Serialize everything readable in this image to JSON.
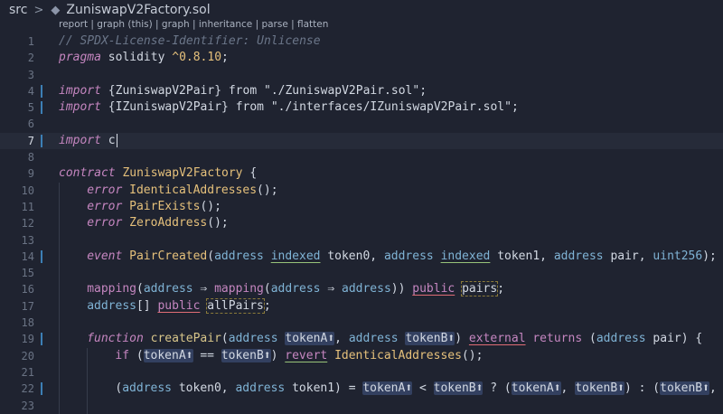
{
  "breadcrumb": {
    "root": "src",
    "separator": ">",
    "file_icon": "ethereum-icon",
    "file": "ZuniswapV2Factory.sol"
  },
  "codelens": "report | graph (this) | graph | inheritance | parse | flatten",
  "colors": {
    "background": "#1f2330",
    "keyword": "#c586c0",
    "type": "#7fb3d5",
    "identifier": "#e5c07b",
    "modified_gutter": "#3c7fb5"
  },
  "lines": [
    {
      "n": "1",
      "t": [
        [
          "c-comment",
          "// SPDX-License-Identifier: Unlicense"
        ]
      ]
    },
    {
      "n": "2",
      "t": [
        [
          "c-kw",
          "pragma"
        ],
        [
          "c-var",
          " solidity "
        ],
        [
          "c-ver",
          "^0.8.10"
        ],
        [
          "c-var",
          ";"
        ]
      ]
    },
    {
      "n": "3",
      "t": []
    },
    {
      "n": "4",
      "mod": true,
      "t": [
        [
          "c-kw",
          "import"
        ],
        [
          "c-var",
          " {ZuniswapV2Pair} "
        ],
        [
          "c-var",
          "from "
        ],
        [
          "c-str",
          "\"./ZuniswapV2Pair.sol\""
        ],
        [
          "c-var",
          ";"
        ]
      ]
    },
    {
      "n": "5",
      "mod": true,
      "t": [
        [
          "c-kw",
          "import"
        ],
        [
          "c-var",
          " {IZuniswapV2Pair} "
        ],
        [
          "c-var",
          "from "
        ],
        [
          "c-str",
          "\"./interfaces/IZuniswapV2Pair.sol\""
        ],
        [
          "c-var",
          ";"
        ]
      ]
    },
    {
      "n": "6",
      "t": []
    },
    {
      "n": "7",
      "mod": true,
      "current": true,
      "cursor": true,
      "t": [
        [
          "c-kw",
          "import"
        ],
        [
          "c-var",
          " c"
        ]
      ]
    },
    {
      "n": "8",
      "t": []
    },
    {
      "n": "9",
      "t": [
        [
          "c-kw",
          "contract"
        ],
        [
          "c-var",
          " "
        ],
        [
          "c-name",
          "ZuniswapV2Factory"
        ],
        [
          "c-var",
          " {"
        ]
      ]
    },
    {
      "n": "10",
      "indent": 1,
      "t": [
        [
          "c-kw",
          "error"
        ],
        [
          "c-var",
          " "
        ],
        [
          "c-name",
          "IdenticalAddresses"
        ],
        [
          "c-var",
          "();"
        ]
      ]
    },
    {
      "n": "11",
      "indent": 1,
      "t": [
        [
          "c-kw",
          "error"
        ],
        [
          "c-var",
          " "
        ],
        [
          "c-name",
          "PairExists"
        ],
        [
          "c-var",
          "();"
        ]
      ]
    },
    {
      "n": "12",
      "indent": 1,
      "t": [
        [
          "c-kw",
          "error"
        ],
        [
          "c-var",
          " "
        ],
        [
          "c-name",
          "ZeroAddress"
        ],
        [
          "c-var",
          "();"
        ]
      ]
    },
    {
      "n": "13",
      "indent": 1,
      "t": []
    },
    {
      "n": "14",
      "mod": true,
      "indent": 1,
      "t": [
        [
          "c-kw",
          "event"
        ],
        [
          "c-var",
          " "
        ],
        [
          "c-name",
          "PairCreated"
        ],
        [
          "c-var",
          "("
        ],
        [
          "c-type",
          "address"
        ],
        [
          "c-var",
          " "
        ],
        [
          "c-type c-ulg",
          "indexed"
        ],
        [
          "c-var",
          " token0, "
        ],
        [
          "c-type",
          "address"
        ],
        [
          "c-var",
          " "
        ],
        [
          "c-type c-ulg",
          "indexed"
        ],
        [
          "c-var",
          " token1, "
        ],
        [
          "c-type",
          "address"
        ],
        [
          "c-var",
          " pair, "
        ],
        [
          "c-type",
          "uint256"
        ],
        [
          "c-var",
          ");"
        ]
      ]
    },
    {
      "n": "15",
      "indent": 1,
      "t": []
    },
    {
      "n": "16",
      "indent": 1,
      "t": [
        [
          "c-kwn",
          "mapping"
        ],
        [
          "c-var",
          "("
        ],
        [
          "c-type",
          "address"
        ],
        [
          "c-var",
          " ⇒ "
        ],
        [
          "c-kwn",
          "mapping"
        ],
        [
          "c-var",
          "("
        ],
        [
          "c-type",
          "address"
        ],
        [
          "c-var",
          " ⇒ "
        ],
        [
          "c-type",
          "address"
        ],
        [
          "c-var",
          ")) "
        ],
        [
          "c-kwn c-ul",
          "public"
        ],
        [
          "c-var",
          " "
        ],
        [
          "c-var c-box",
          "pairs"
        ],
        [
          "c-var",
          ";"
        ]
      ]
    },
    {
      "n": "17",
      "indent": 1,
      "t": [
        [
          "c-type",
          "address"
        ],
        [
          "c-var",
          "[] "
        ],
        [
          "c-kwn c-ul",
          "public"
        ],
        [
          "c-var",
          " "
        ],
        [
          "c-var c-box",
          "allPairs"
        ],
        [
          "c-var",
          ";"
        ]
      ]
    },
    {
      "n": "18",
      "indent": 1,
      "t": []
    },
    {
      "n": "19",
      "mod": true,
      "indent": 1,
      "t": [
        [
          "c-kw",
          "function"
        ],
        [
          "c-var",
          " "
        ],
        [
          "c-fn",
          "createPair"
        ],
        [
          "c-var",
          "("
        ],
        [
          "c-type",
          "address"
        ],
        [
          "c-var",
          " "
        ],
        [
          "c-var c-hl",
          "tokenA⬆"
        ],
        [
          "c-var",
          ", "
        ],
        [
          "c-type",
          "address"
        ],
        [
          "c-var",
          " "
        ],
        [
          "c-var c-hl",
          "tokenB⬆"
        ],
        [
          "c-var",
          ") "
        ],
        [
          "c-kwn c-ul",
          "external"
        ],
        [
          "c-var",
          " "
        ],
        [
          "c-kwn",
          "returns"
        ],
        [
          "c-var",
          " ("
        ],
        [
          "c-type",
          "address"
        ],
        [
          "c-var",
          " pair) {"
        ]
      ]
    },
    {
      "n": "20",
      "indent": 2,
      "t": [
        [
          "c-kwn",
          "if"
        ],
        [
          "c-var",
          " ("
        ],
        [
          "c-var c-hl",
          "tokenA⬆"
        ],
        [
          "c-var",
          " == "
        ],
        [
          "c-var c-hl",
          "tokenB⬆"
        ],
        [
          "c-var",
          ") "
        ],
        [
          "c-kwn c-ulg",
          "revert"
        ],
        [
          "c-var",
          " "
        ],
        [
          "c-name",
          "IdenticalAddresses"
        ],
        [
          "c-var",
          "();"
        ]
      ]
    },
    {
      "n": "21",
      "indent": 2,
      "t": []
    },
    {
      "n": "22",
      "mod": true,
      "indent": 2,
      "t": [
        [
          "c-var",
          "("
        ],
        [
          "c-type",
          "address"
        ],
        [
          "c-var",
          " token0, "
        ],
        [
          "c-type",
          "address"
        ],
        [
          "c-var",
          " token1) = "
        ],
        [
          "c-var c-hl",
          "tokenA⬆"
        ],
        [
          "c-var",
          " < "
        ],
        [
          "c-var c-hl",
          "tokenB⬆"
        ],
        [
          "c-var",
          " ? ("
        ],
        [
          "c-var c-hl",
          "tokenA⬆"
        ],
        [
          "c-var",
          ", "
        ],
        [
          "c-var c-hl",
          "tokenB⬆"
        ],
        [
          "c-var",
          ") : ("
        ],
        [
          "c-var c-hl",
          "tokenB⬆"
        ],
        [
          "c-var",
          ", toke"
        ]
      ]
    },
    {
      "n": "23",
      "indent": 2,
      "t": []
    }
  ]
}
